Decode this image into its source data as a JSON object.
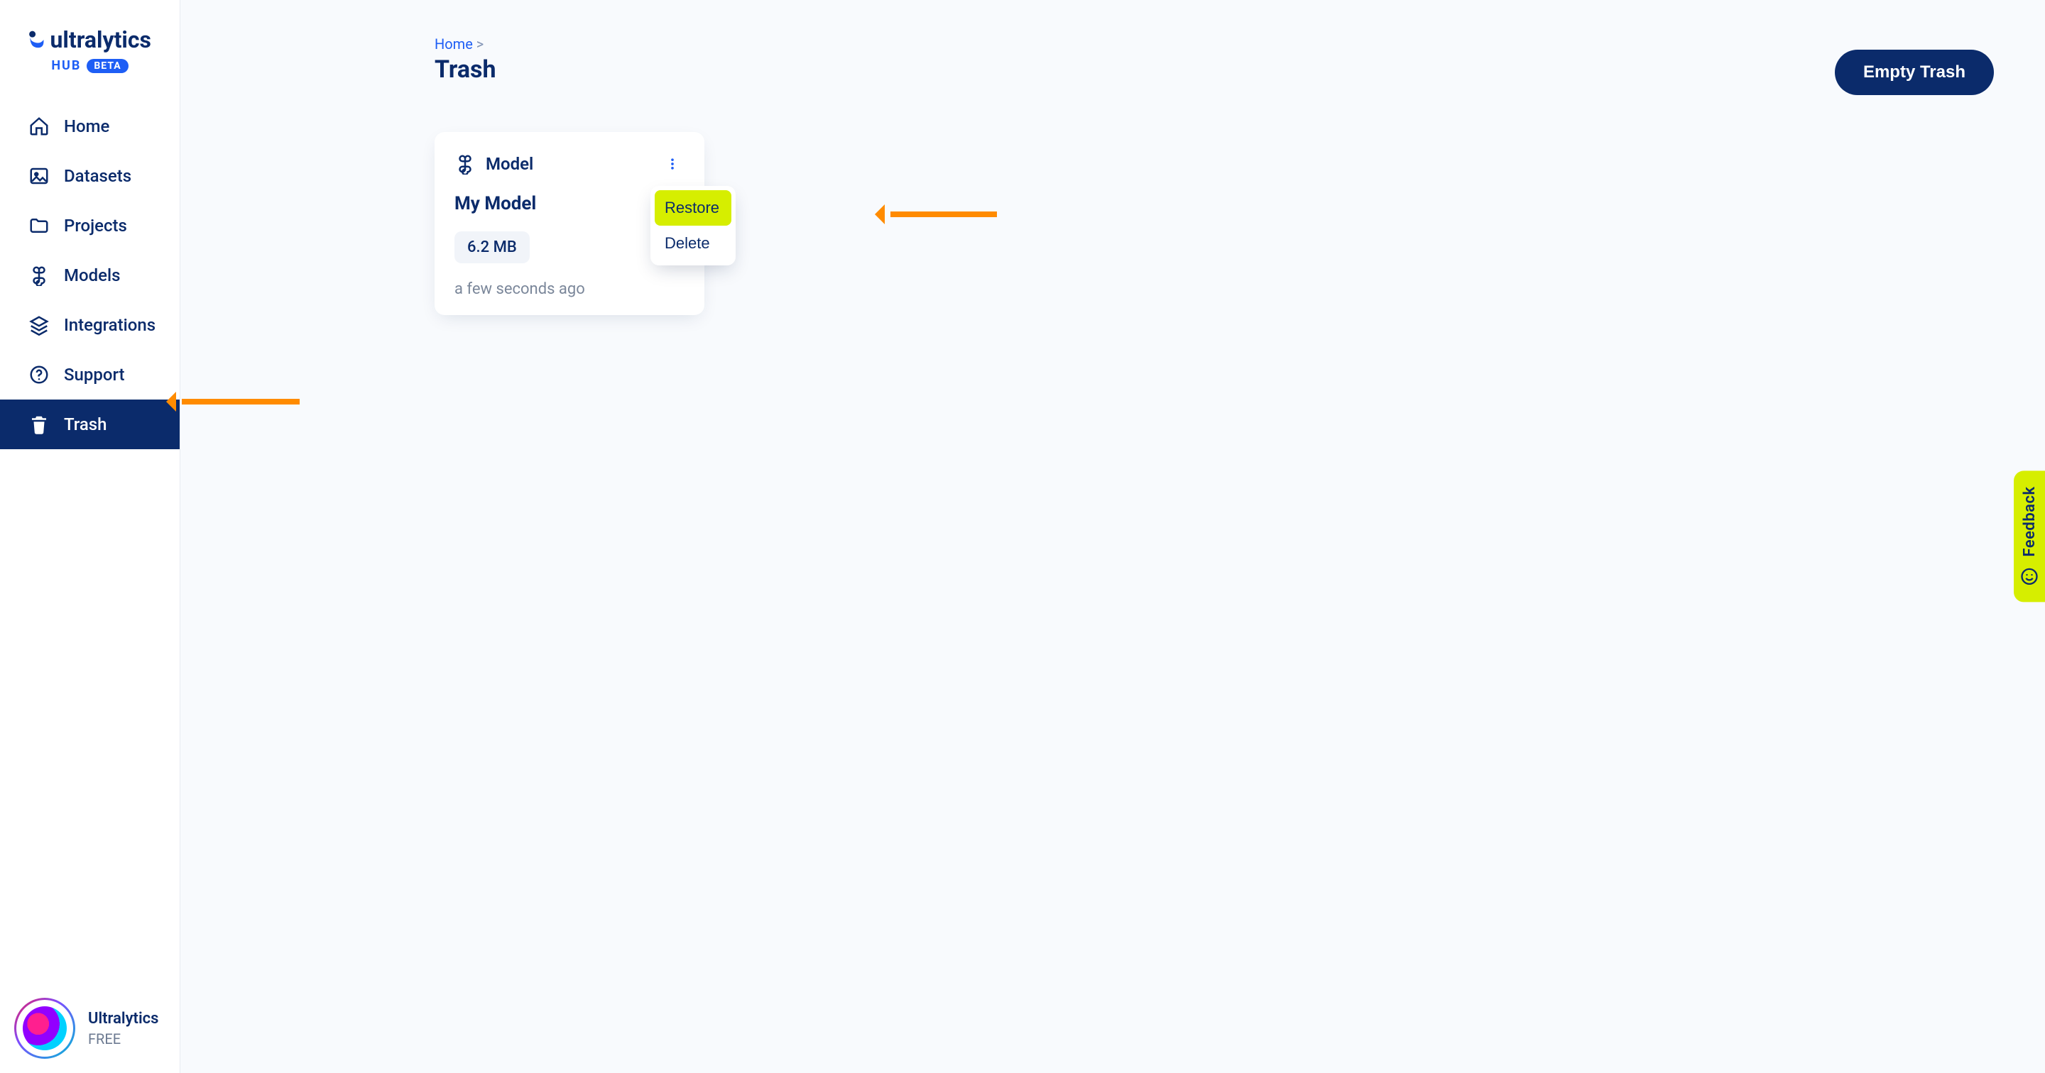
{
  "brand": {
    "name": "ultralytics",
    "sub": "HUB",
    "badge": "BETA"
  },
  "nav": {
    "home": "Home",
    "datasets": "Datasets",
    "projects": "Projects",
    "models": "Models",
    "integrations": "Integrations",
    "support": "Support",
    "trash": "Trash"
  },
  "user": {
    "name": "Ultralytics",
    "plan": "FREE"
  },
  "crumbs": {
    "home": "Home",
    "sep": ">"
  },
  "page": {
    "title": "Trash"
  },
  "actions": {
    "empty_trash": "Empty Trash"
  },
  "card": {
    "type_label": "Model",
    "title": "My Model",
    "size": "6.2 MB",
    "time": "a few seconds ago",
    "menu": {
      "restore": "Restore",
      "delete": "Delete"
    }
  },
  "feedback": {
    "label": "Feedback"
  }
}
